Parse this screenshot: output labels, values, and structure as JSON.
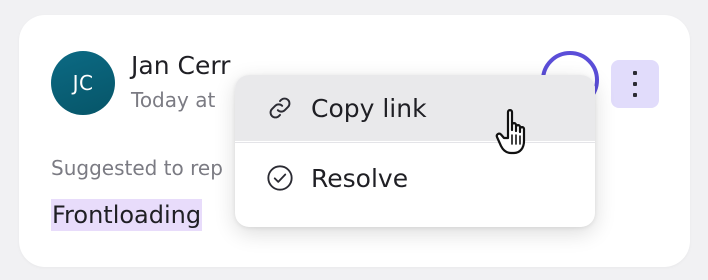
{
  "comment": {
    "avatar_initials": "JC",
    "author_name": "Jan Cerr",
    "timestamp": "Today at",
    "suggestion_label": "Suggested to rep",
    "suggested_text": "Frontloading"
  },
  "menu": {
    "items": [
      {
        "label": "Copy link",
        "icon": "link-icon"
      },
      {
        "label": "Resolve",
        "icon": "check-circle-icon"
      }
    ]
  },
  "colors": {
    "avatar": "#0c6a84",
    "accent": "#5b4ed8",
    "highlight": "#e8dcfb",
    "more_button_bg": "#e1dcfb",
    "menu_hover": "#e9e9eb"
  },
  "icons": {
    "more": "more-vertical-icon",
    "cursor": "hand-pointer-cursor"
  }
}
